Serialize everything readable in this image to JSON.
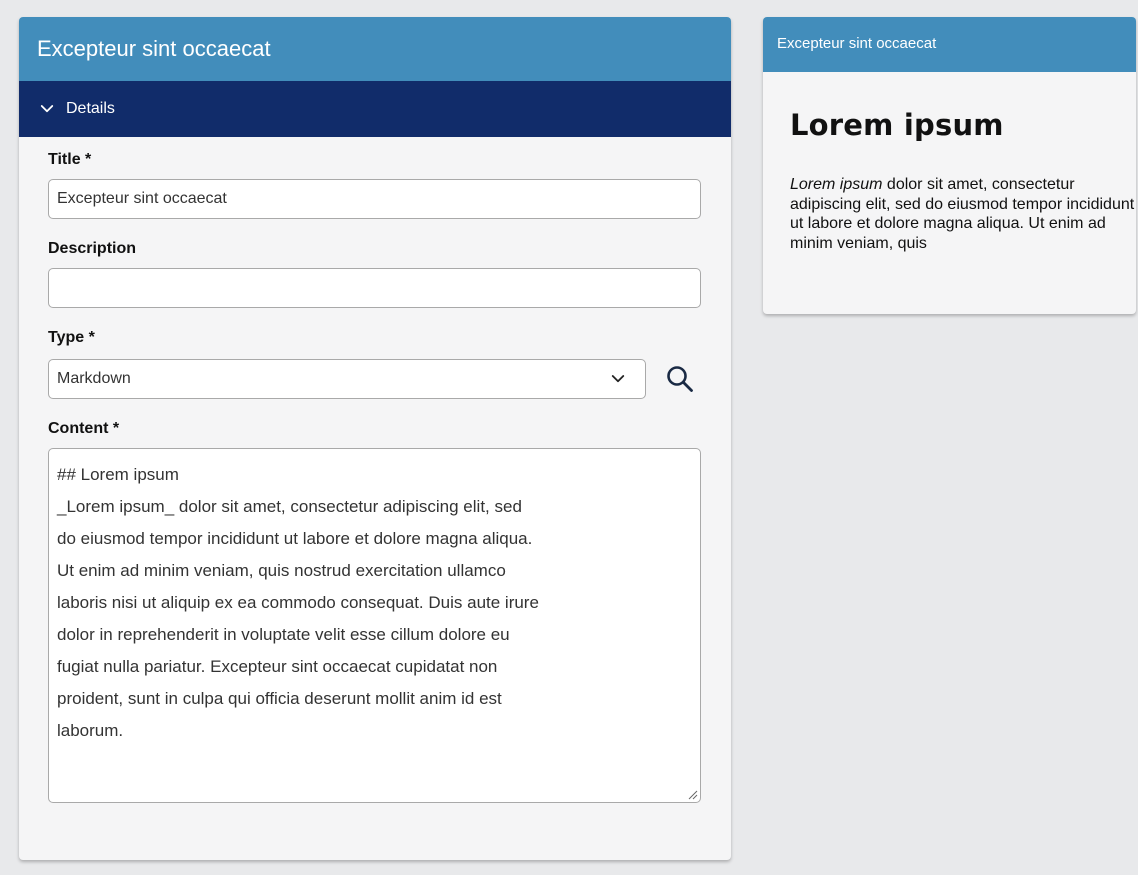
{
  "editor": {
    "header_title": "Excepteur sint occaecat",
    "details_label": "Details",
    "fields": {
      "title": {
        "label": "Title *",
        "value": "Excepteur sint occaecat"
      },
      "description": {
        "label": "Description",
        "value": ""
      },
      "type": {
        "label": "Type *",
        "selected": "Markdown"
      },
      "content": {
        "label": "Content *",
        "lines": [
          "## Lorem ipsum",
          "_Lorem ipsum_ dolor sit amet, consectetur adipiscing elit, sed",
          "do eiusmod tempor incididunt ut labore et dolore magna aliqua.",
          "Ut enim ad minim veniam, quis nostrud exercitation ullamco",
          "laboris nisi ut aliquip ex ea commodo consequat. Duis aute irure",
          "dolor in reprehenderit in voluptate velit esse cillum dolore eu",
          "fugiat nulla pariatur. Excepteur sint occaecat cupidatat non",
          "proident, sunt in culpa qui officia deserunt mollit anim id est",
          "laborum."
        ]
      }
    }
  },
  "preview": {
    "header_title": "Excepteur sint occaecat",
    "heading": "Lorem ipsum",
    "text_italic": "Lorem ipsum",
    "text_rest": " dolor sit amet, consectetur adipiscing elit, sed do eiusmod tempor incididunt ut labore et dolore magna aliqua. Ut enim ad minim veniam, quis"
  },
  "icons": {
    "details_toggle": "chevron-down-icon",
    "select_toggle": "chevron-down-icon",
    "search": "search-icon",
    "resize": "resize-grip-icon"
  },
  "colors": {
    "header_blue": "#428dbb",
    "details_navy": "#112c6a",
    "background": "#e8e9eb"
  }
}
